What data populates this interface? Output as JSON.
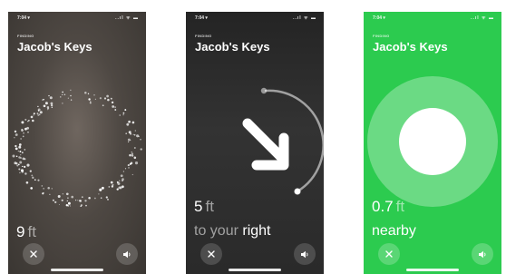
{
  "screens": [
    {
      "status_time": "7:04 ▾",
      "status_icons": "..ıl ᯤ ▬",
      "finding_label": "FINDING",
      "title": "Jacob's Keys",
      "distance_value": "9",
      "distance_unit": "ft"
    },
    {
      "status_time": "7:04 ▾",
      "status_icons": "..ıl ᯤ ▬",
      "finding_label": "FINDING",
      "title": "Jacob's Keys",
      "distance_value": "5",
      "distance_unit": "ft",
      "direction_prefix": "to your ",
      "direction_emphasis": "right"
    },
    {
      "status_time": "7:04 ▾",
      "status_icons": "..ıl ᯤ ▬",
      "finding_label": "FINDING",
      "title": "Jacob's Keys",
      "distance_value": "0.7",
      "distance_unit": "ft",
      "direction_prefix": "nearby"
    }
  ],
  "colors": {
    "green_background": "#2ccb4f",
    "dark_background": "#2a2a2a",
    "blurred_background": "#4e4843"
  },
  "icons": {
    "close": "close-icon",
    "sound": "speaker-icon",
    "arrow": "direction-arrow-icon"
  }
}
